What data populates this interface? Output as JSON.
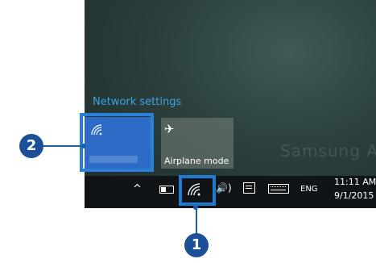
{
  "flyout": {
    "network_settings_label": "Network settings",
    "wifi_tile_icon": "wifi-icon",
    "airplane_tile": {
      "icon": "airplane-icon",
      "label": "Airplane mode"
    },
    "watermark": "Samsung ATIV"
  },
  "taskbar": {
    "icons": [
      "chevron-up-icon",
      "battery-icon",
      "wifi-icon",
      "volume-icon",
      "action-center-icon",
      "keyboard-icon"
    ],
    "chevron": "^",
    "volume": "🔊)",
    "language": "ENG",
    "time": "11:11 AM",
    "date": "9/1/2015"
  },
  "callouts": {
    "one": "1",
    "two": "2"
  },
  "colors": {
    "accent": "#2d6bc6",
    "callout": "#1b4f97",
    "link": "#3fa0e6",
    "taskbar": "#101417"
  }
}
